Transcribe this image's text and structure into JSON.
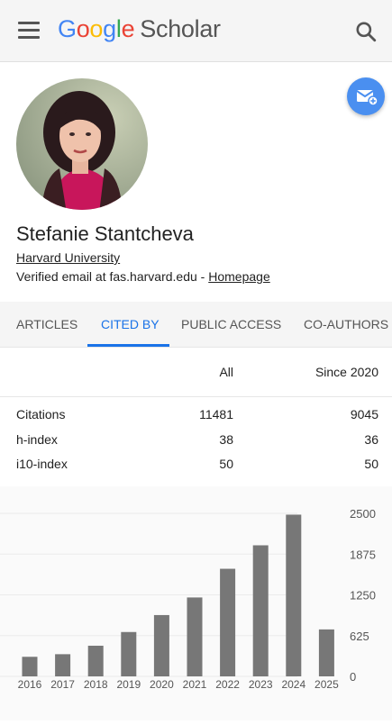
{
  "header": {
    "brand_google_letters": [
      "G",
      "o",
      "o",
      "g",
      "l",
      "e"
    ],
    "brand_scholar": "Scholar",
    "icons": [
      "menu-icon",
      "search-icon"
    ]
  },
  "profile": {
    "name": "Stefanie Stantcheva",
    "affiliation": "Harvard University",
    "verified_prefix": "Verified email at fas.harvard.edu - ",
    "homepage_label": "Homepage",
    "fab_icon": "email-add-icon"
  },
  "tabs": [
    {
      "label": "ARTICLES",
      "active": false
    },
    {
      "label": "CITED BY",
      "active": true
    },
    {
      "label": "PUBLIC ACCESS",
      "active": false
    },
    {
      "label": "CO-AUTHORS",
      "active": false
    }
  ],
  "stats": {
    "col_all": "All",
    "col_since": "Since 2020",
    "rows": [
      {
        "label": "Citations",
        "all": "11481",
        "since": "9045"
      },
      {
        "label": "h-index",
        "all": "38",
        "since": "36"
      },
      {
        "label": "i10-index",
        "all": "50",
        "since": "50"
      }
    ]
  },
  "colors": {
    "accent": "#1a73e8",
    "fab": "#4a8ff0",
    "bar": "#777777"
  },
  "chart_data": {
    "type": "bar",
    "categories": [
      "2016",
      "2017",
      "2018",
      "2019",
      "2020",
      "2021",
      "2022",
      "2023",
      "2024",
      "2025"
    ],
    "values": [
      300,
      340,
      470,
      680,
      940,
      1210,
      1650,
      2010,
      2480,
      720
    ],
    "yticks": [
      "2500",
      "1875",
      "1250",
      "625",
      "0"
    ],
    "ylim": [
      0,
      2500
    ],
    "grid": true,
    "title": "",
    "xlabel": "",
    "ylabel": ""
  }
}
